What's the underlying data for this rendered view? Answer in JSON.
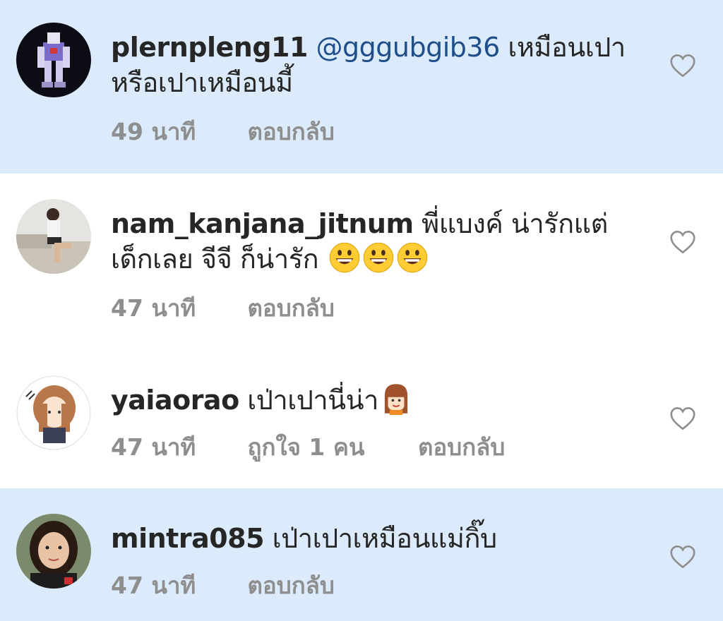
{
  "comments": [
    {
      "username": "plernpleng11",
      "mention": "@gggubgib36",
      "text_line1": "เหมือนเปา",
      "text_line2": "หรือเปาเหมือนมี้",
      "time": "49 นาที",
      "reply": "ตอบกลับ",
      "highlighted": true
    },
    {
      "username": "nam_kanjana_jitnum",
      "text_line1": "พี่แบงค์ น่ารักแต่",
      "text_line2": "เด็กเลย จีจี ก็น่ารัก",
      "emoji_names": [
        "grinning-face-emoji",
        "grinning-face-emoji",
        "grinning-face-emoji"
      ],
      "time": "47 นาที",
      "reply": "ตอบกลับ",
      "highlighted": false
    },
    {
      "username": "yaiaorao",
      "text_line1": "เป่าเปานี่น่า",
      "emoji_names": [
        "girl-emoji"
      ],
      "time": "47 นาที",
      "likes": "ถูกใจ 1 คน",
      "reply": "ตอบกลับ",
      "highlighted": false
    },
    {
      "username": "mintra085",
      "text_line1": "เป่าเปาเหมือนแม่กิ๊บ",
      "time": "47 นาที",
      "reply": "ตอบกลับ",
      "highlighted": true
    }
  ],
  "colors": {
    "highlight_bg": "#dcebfb",
    "meta_text": "#8e8e8e",
    "mention": "#1f4f8a",
    "heart_outline": "#8e8e8e"
  },
  "icons": {
    "like": "heart-outline-icon"
  }
}
